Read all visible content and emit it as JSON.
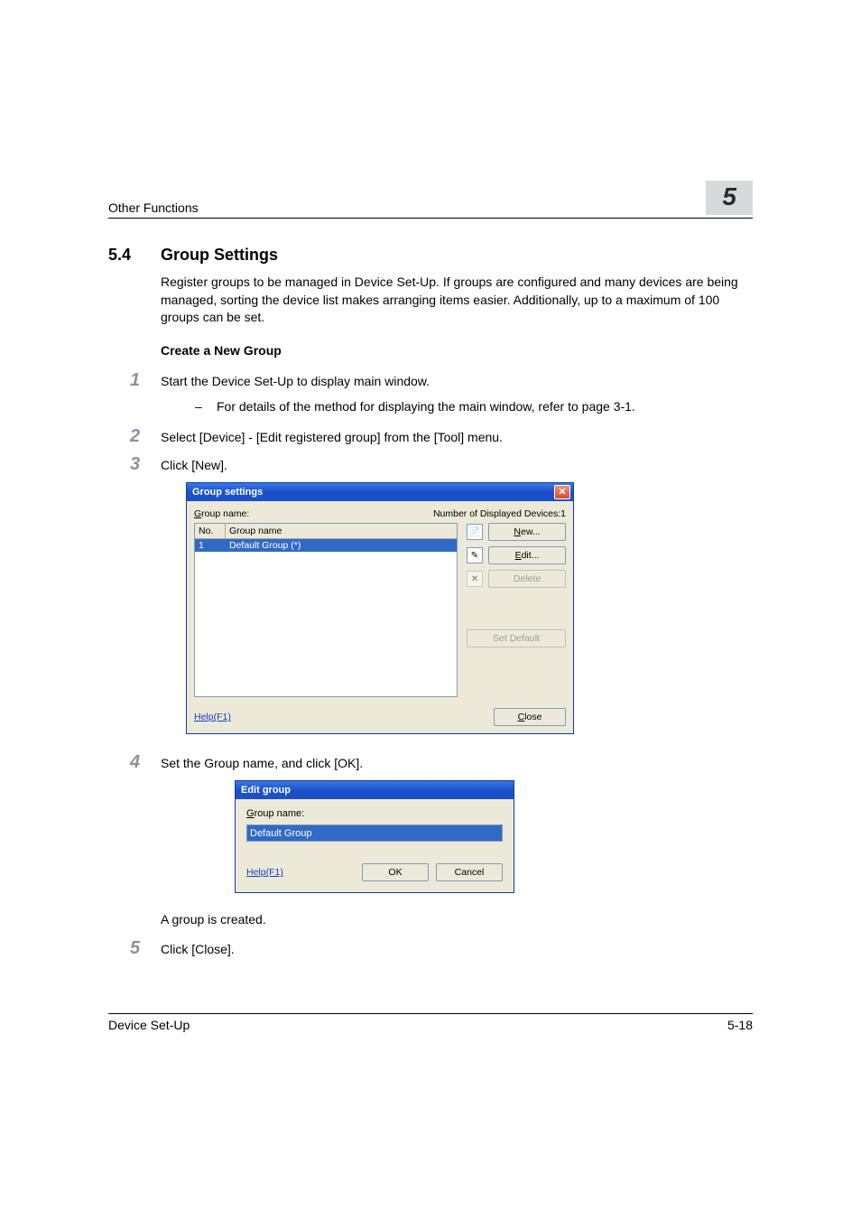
{
  "header": {
    "title": "Other Functions",
    "chapter": "5"
  },
  "section": {
    "num": "5.4",
    "title": "Group Settings"
  },
  "intro": "Register groups to be managed in Device Set-Up. If groups are configured and many devices are being managed, sorting the device list makes arranging items easier. Additionally, up to a maximum of 100 groups can be set.",
  "subhead": "Create a New Group",
  "steps": {
    "s1": {
      "num": "1",
      "text": "Start the Device Set-Up to display main window."
    },
    "s1a": "For details of the method for displaying the main window, refer to page 3-1.",
    "s2": {
      "num": "2",
      "text": "Select [Device] - [Edit registered group] from the [Tool] menu."
    },
    "s3": {
      "num": "3",
      "text": "Click [New]."
    },
    "s4": {
      "num": "4",
      "text": "Set the Group name, and click [OK]."
    },
    "s4b": "A group is created.",
    "s5": {
      "num": "5",
      "text": "Click [Close]."
    }
  },
  "dlg_group": {
    "title": "Group settings",
    "group_label": "Group name:",
    "count_label": "Number of Displayed Devices:1",
    "col_no": "No.",
    "col_name": "Group name",
    "row1_no": "1",
    "row1_name": "Default Group (*)",
    "btn_new": "New...",
    "btn_edit": "Edit...",
    "btn_delete": "Delete",
    "btn_setdefault": "Set Default",
    "help": "Help(F1)",
    "btn_close": "Close"
  },
  "dlg_edit": {
    "title": "Edit group",
    "label": "Group name:",
    "value": "Default Group",
    "help": "Help(F1)",
    "btn_ok": "OK",
    "btn_cancel": "Cancel"
  },
  "footer": {
    "left": "Device Set-Up",
    "right": "5-18"
  }
}
